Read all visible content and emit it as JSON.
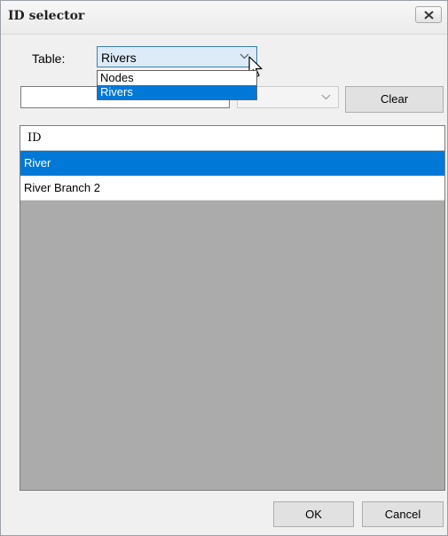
{
  "window": {
    "title": "ID selector"
  },
  "table_selector": {
    "label": "Table:",
    "selected": "Rivers",
    "options": [
      "Nodes",
      "Rivers"
    ]
  },
  "filter": {
    "text_value": "",
    "select_value": "",
    "clear_label": "Clear"
  },
  "grid": {
    "column_header": "ID",
    "rows": [
      "River",
      "River Branch 2"
    ],
    "selected_row": "River"
  },
  "footer": {
    "ok_label": "OK",
    "cancel_label": "Cancel"
  },
  "colors": {
    "selection": "#0078d7",
    "grid_background": "#ababab",
    "select_highlight": "#ddeaf8"
  }
}
